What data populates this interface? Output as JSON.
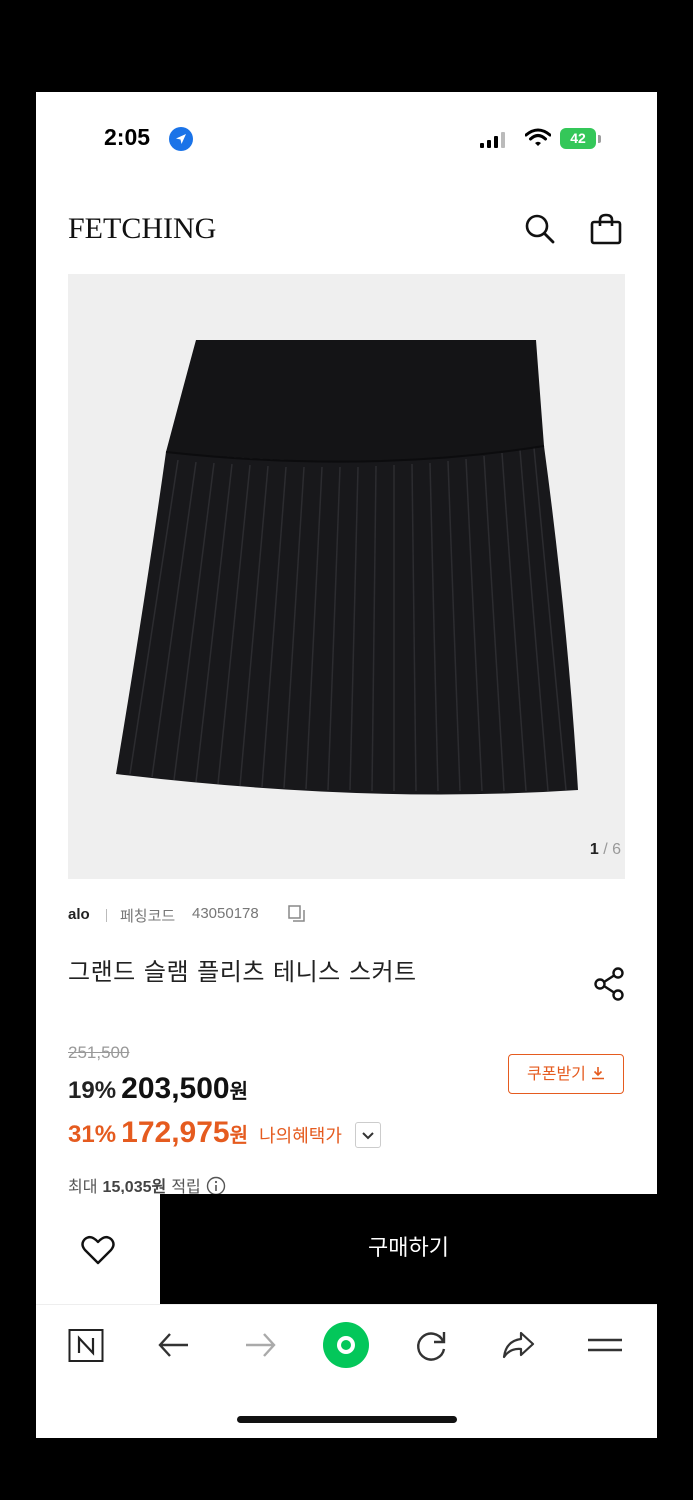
{
  "status_bar": {
    "time": "2:05",
    "battery": "42"
  },
  "header": {
    "logo": "FETCHING"
  },
  "gallery": {
    "current": "1",
    "separator": "/",
    "total": "6"
  },
  "product": {
    "brand": "alo",
    "code_label": "페칭코드",
    "code": "43050178",
    "title": "그랜드 슬램 플리츠 테니스 스커트",
    "original_price": "251,500",
    "discount_pct": "19%",
    "price": "203,500",
    "price_unit": "원",
    "benefit_pct": "31%",
    "benefit_price": "172,975",
    "benefit_unit": "원",
    "benefit_label": "나의혜택가",
    "points_prefix": "최대",
    "points_value": "15,035원",
    "points_suffix": "적립"
  },
  "coupon_button": {
    "label": "쿠폰받기"
  },
  "action_bar": {
    "buy_label": "구매하기"
  },
  "colors": {
    "accent": "#e55b1f",
    "buy_bg": "#000000",
    "naver_green": "#03c75a"
  },
  "icons": [
    "location-arrow-icon",
    "cellular-signal-icon",
    "wifi-icon",
    "battery-icon",
    "search-icon",
    "shopping-bag-icon",
    "copy-icon",
    "share-icon",
    "download-icon",
    "chevron-down-icon",
    "info-icon",
    "heart-icon",
    "naver-n-icon",
    "back-arrow-icon",
    "forward-arrow-icon",
    "naver-green-dot-icon",
    "refresh-icon",
    "share-arrow-icon",
    "menu-icon"
  ]
}
